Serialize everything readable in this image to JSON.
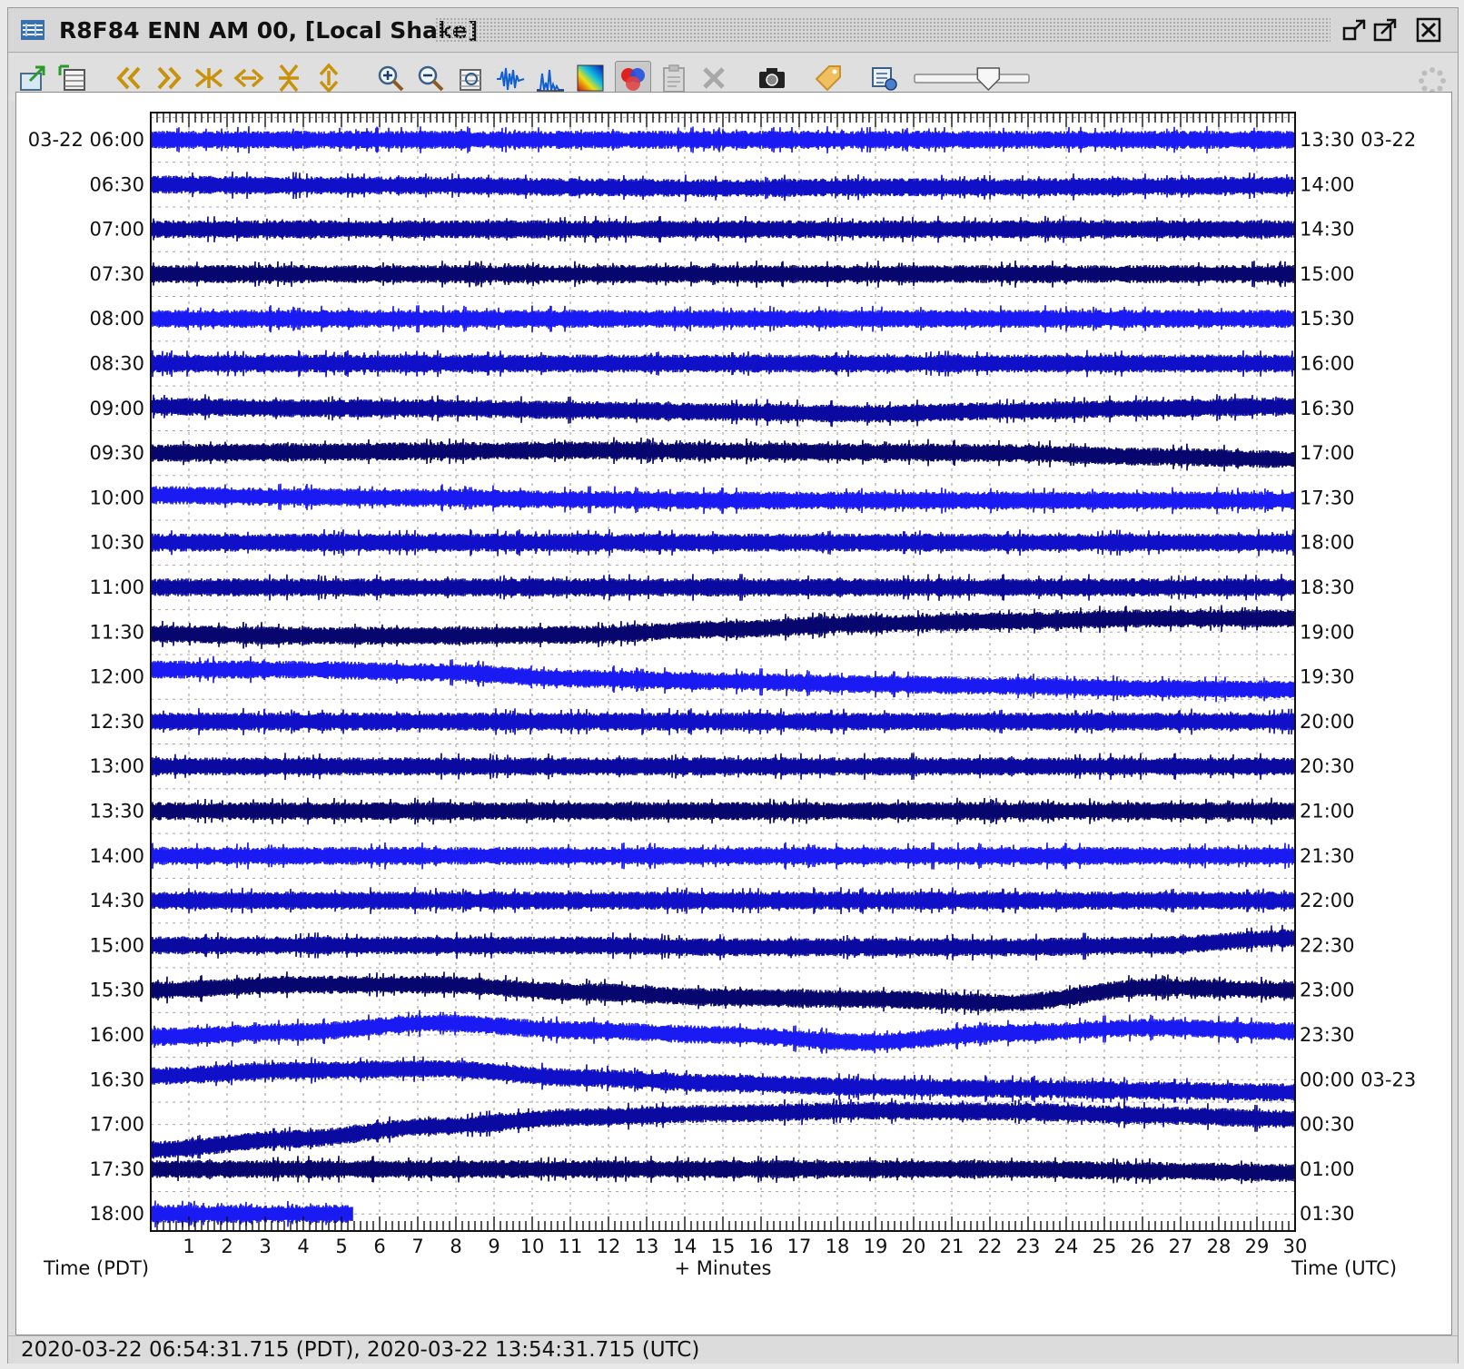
{
  "window": {
    "title": "R8F84 ENN AM 00, [Local Shake]"
  },
  "toolbar": {
    "buttons": [
      {
        "icon": "export-icon"
      },
      {
        "icon": "layout-icon"
      },
      {
        "icon": "scroll-left-icon"
      },
      {
        "icon": "scroll-right-icon"
      },
      {
        "icon": "compress-horizontal-icon"
      },
      {
        "icon": "expand-horizontal-icon"
      },
      {
        "icon": "compress-vertical-icon"
      },
      {
        "icon": "expand-vertical-icon"
      },
      {
        "icon": "zoom-in-icon"
      },
      {
        "icon": "zoom-out-icon"
      },
      {
        "icon": "zoom-fit-icon"
      },
      {
        "icon": "waveform-icon"
      },
      {
        "icon": "spectrum-icon"
      },
      {
        "icon": "spectrogram-icon"
      },
      {
        "icon": "color-balls-icon"
      },
      {
        "icon": "clipboard-icon"
      },
      {
        "icon": "clear-icon"
      },
      {
        "icon": "camera-icon"
      },
      {
        "icon": "tag-icon"
      },
      {
        "icon": "settings-icon"
      }
    ],
    "slider_value": 0.65
  },
  "chart_data": {
    "type": "line",
    "title": "",
    "xlabel": "+ Minutes",
    "left_axis_title": "Time (PDT)",
    "right_axis_title": "Time (UTC)",
    "x_ticks": [
      "1",
      "2",
      "3",
      "4",
      "5",
      "6",
      "7",
      "8",
      "9",
      "10",
      "11",
      "12",
      "13",
      "14",
      "15",
      "16",
      "17",
      "18",
      "19",
      "20",
      "21",
      "22",
      "23",
      "24",
      "25",
      "26",
      "27",
      "28",
      "29",
      "30"
    ],
    "xlim": [
      0,
      30
    ],
    "grid": true,
    "rows": [
      {
        "left": "03-22 06:00",
        "right": "13:30 03-22",
        "color": "#1a1af2",
        "offset": [
          0,
          0,
          0,
          0,
          0,
          0,
          0,
          0,
          0
        ]
      },
      {
        "left": "06:30",
        "right": "14:00",
        "color": "#1010c8",
        "offset": [
          0,
          1,
          1,
          3,
          4,
          3,
          3,
          2,
          1
        ]
      },
      {
        "left": "07:00",
        "right": "14:30",
        "color": "#0a0aa0",
        "offset": [
          0,
          0,
          0,
          0,
          0,
          0,
          0,
          0,
          0
        ]
      },
      {
        "left": "07:30",
        "right": "15:00",
        "color": "#06066e",
        "offset": [
          0,
          0,
          0,
          0,
          0,
          0,
          0,
          0,
          0
        ]
      },
      {
        "left": "08:00",
        "right": "15:30",
        "color": "#1a1af2",
        "offset": [
          0,
          0,
          0,
          0,
          0,
          0,
          0,
          0,
          0
        ]
      },
      {
        "left": "08:30",
        "right": "16:00",
        "color": "#1010c8",
        "offset": [
          0,
          0,
          0,
          0,
          0,
          0,
          0,
          0,
          0
        ]
      },
      {
        "left": "09:00",
        "right": "16:30",
        "color": "#0a0aa0",
        "offset": [
          -2,
          0,
          0,
          2,
          4,
          6,
          3,
          0,
          -2
        ]
      },
      {
        "left": "09:30",
        "right": "17:00",
        "color": "#06066e",
        "offset": [
          0,
          -1,
          -2,
          -3,
          -2,
          -1,
          0,
          4,
          7
        ]
      },
      {
        "left": "10:00",
        "right": "17:30",
        "color": "#1a1af2",
        "offset": [
          -3,
          -1,
          0,
          2,
          3,
          3,
          3,
          3,
          3
        ]
      },
      {
        "left": "10:30",
        "right": "18:00",
        "color": "#1010c8",
        "offset": [
          0,
          0,
          0,
          0,
          0,
          0,
          0,
          0,
          0
        ]
      },
      {
        "left": "11:00",
        "right": "18:30",
        "color": "#0a0aa0",
        "offset": [
          0,
          0,
          0,
          0,
          0,
          0,
          0,
          0,
          0
        ]
      },
      {
        "left": "11:30",
        "right": "19:00",
        "color": "#06066e",
        "offset": [
          2,
          4,
          4,
          3,
          -3,
          -9,
          -12,
          -15,
          -15
        ]
      },
      {
        "left": "12:00",
        "right": "19:30",
        "color": "#1a1af2",
        "offset": [
          -8,
          -8,
          -5,
          2,
          5,
          8,
          10,
          13,
          14
        ]
      },
      {
        "left": "12:30",
        "right": "20:00",
        "color": "#1010c8",
        "offset": [
          0,
          0,
          0,
          0,
          0,
          0,
          0,
          0,
          0
        ]
      },
      {
        "left": "13:00",
        "right": "20:30",
        "color": "#0a0aa0",
        "offset": [
          0,
          0,
          0,
          0,
          0,
          0,
          0,
          0,
          0
        ]
      },
      {
        "left": "13:30",
        "right": "21:00",
        "color": "#06066e",
        "offset": [
          0,
          0,
          0,
          0,
          0,
          0,
          0,
          0,
          0
        ]
      },
      {
        "left": "14:00",
        "right": "21:30",
        "color": "#1a1af2",
        "offset": [
          0,
          0,
          0,
          0,
          0,
          0,
          0,
          0,
          0
        ]
      },
      {
        "left": "14:30",
        "right": "22:00",
        "color": "#1010c8",
        "offset": [
          0,
          0,
          0,
          0,
          0,
          0,
          0,
          0,
          0
        ]
      },
      {
        "left": "15:00",
        "right": "22:30",
        "color": "#0a0aa0",
        "offset": [
          0,
          0,
          0,
          0,
          2,
          2,
          2,
          0,
          -8
        ]
      },
      {
        "left": "15:30",
        "right": "23:00",
        "color": "#06066e",
        "offset": [
          0,
          -6,
          -6,
          2,
          8,
          10,
          14,
          -3,
          0
        ]
      },
      {
        "left": "16:00",
        "right": "23:30",
        "color": "#1a1af2",
        "offset": [
          2,
          -3,
          -13,
          -5,
          0,
          8,
          -2,
          -8,
          -4
        ]
      },
      {
        "left": "16:30",
        "right": "00:00 03-23",
        "color": "#1010c8",
        "offset": [
          -4,
          -10,
          -12,
          -2,
          4,
          8,
          10,
          12,
          14
        ]
      },
      {
        "left": "17:00",
        "right": "00:30",
        "color": "#0a0aa0",
        "offset": [
          28,
          16,
          2,
          -8,
          -12,
          -15,
          -14,
          -10,
          -6
        ]
      },
      {
        "left": "17:30",
        "right": "01:00",
        "color": "#06066e",
        "offset": [
          0,
          0,
          0,
          0,
          0,
          0,
          0,
          2,
          4
        ]
      },
      {
        "left": "18:00",
        "right": "01:30",
        "color": "#1a1af2",
        "offset": [
          0
        ],
        "end_minute": 5.3
      }
    ]
  },
  "status": {
    "text": "2020-03-22 06:54:31.715 (PDT), 2020-03-22 13:54:31.715 (UTC)"
  }
}
